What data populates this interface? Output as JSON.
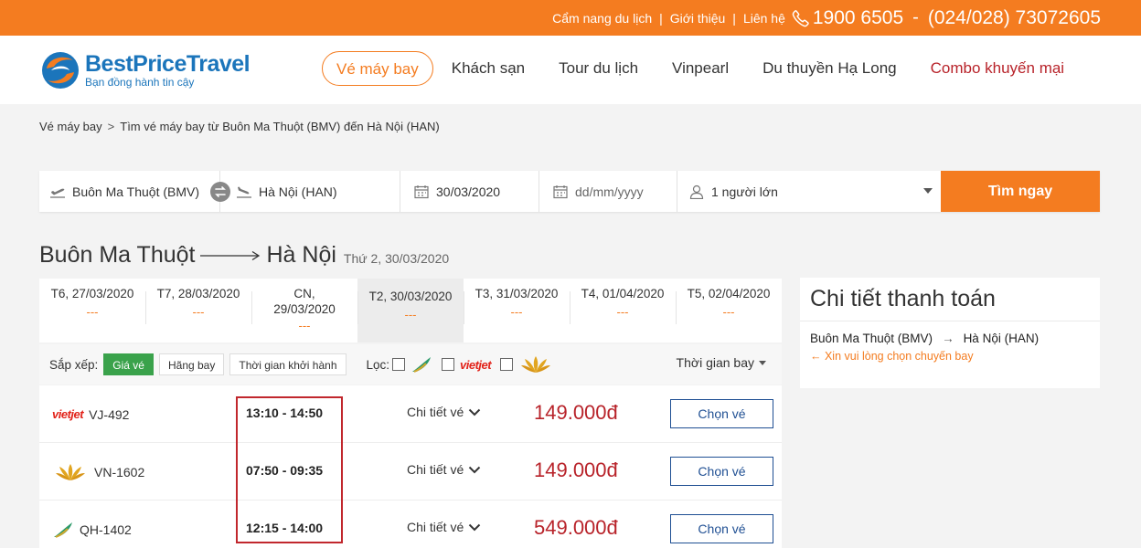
{
  "topbar": {
    "links": [
      "Cẩm nang du lịch",
      "Giới thiệu",
      "Liên hệ"
    ],
    "separator": "|",
    "hotline_1": "1900 6505",
    "hotline_sep": "-",
    "hotline_2": "(024/028) 73072605"
  },
  "header": {
    "logo_name": "BestPriceTravel",
    "logo_tagline": "Bạn đồng hành tin cậy",
    "nav": [
      {
        "label": "Vé máy bay"
      },
      {
        "label": "Khách sạn"
      },
      {
        "label": "Tour du lịch"
      },
      {
        "label": "Vinpearl"
      },
      {
        "label": "Du thuyền Hạ Long"
      },
      {
        "label": "Combo khuyến mại"
      }
    ]
  },
  "breadcrumb": {
    "home": "Vé máy bay",
    "chevron": ">",
    "current": "Tìm vé máy bay từ Buôn Ma Thuột (BMV) đến Hà Nội (HAN)"
  },
  "search": {
    "from": "Buôn Ma Thuột (BMV)",
    "to": "Hà Nội (HAN)",
    "depart_date": "30/03/2020",
    "return_placeholder": "dd/mm/yyyy",
    "passengers": "1 người lớn",
    "button": "Tìm ngay"
  },
  "route": {
    "from_city": "Buôn Ma Thuột",
    "to_city": "Hà Nội",
    "date": "Thứ 2, 30/03/2020"
  },
  "date_tabs": [
    {
      "line1": "T6, 27/03/2020",
      "line2": "",
      "price": "---"
    },
    {
      "line1": "T7, 28/03/2020",
      "line2": "",
      "price": "---"
    },
    {
      "line1": "CN,",
      "line2": "29/03/2020",
      "price": "---"
    },
    {
      "line1": "T2, 30/03/2020",
      "line2": "",
      "price": "---"
    },
    {
      "line1": "T3, 31/03/2020",
      "line2": "",
      "price": "---"
    },
    {
      "line1": "T4, 01/04/2020",
      "line2": "",
      "price": "---"
    },
    {
      "line1": "T5, 02/04/2020",
      "line2": "",
      "price": "---"
    }
  ],
  "filter": {
    "sort_label": "Sắp xếp:",
    "sort_options": [
      "Giá vé",
      "Hãng bay",
      "Thời gian khởi hành"
    ],
    "loc_label": "Lọc:",
    "vietjet_logo_text": "vietjet",
    "sort_time": "Thời gian bay"
  },
  "flights": [
    {
      "airline": "vietjet",
      "logo_text": "vietjet",
      "code": "VJ-492",
      "time": "13:10 - 14:50",
      "detail": "Chi tiết vé",
      "price": "149.000đ",
      "button": "Chọn vé"
    },
    {
      "airline": "vietnam-airlines",
      "logo_text": "",
      "code": "VN-1602",
      "time": "07:50 - 09:35",
      "detail": "Chi tiết vé",
      "price": "149.000đ",
      "button": "Chọn vé"
    },
    {
      "airline": "bamboo",
      "logo_text": "",
      "code": "QH-1402",
      "time": "12:15 - 14:00",
      "detail": "Chi tiết vé",
      "price": "549.000đ",
      "button": "Chọn vé"
    }
  ],
  "payment": {
    "title": "Chi tiết thanh toán",
    "from": "Buôn Ma Thuột (BMV)",
    "arrow": "→",
    "to": "Hà Nội (HAN)",
    "note": "← Xin vui lòng chọn chuyến bay"
  },
  "colors": {
    "brand_orange": "#f47c20",
    "brand_blue": "#1b75bb",
    "price_red": "#b8232a",
    "highlight_red": "#c1272d",
    "sort_active_green": "#3aa24b"
  }
}
